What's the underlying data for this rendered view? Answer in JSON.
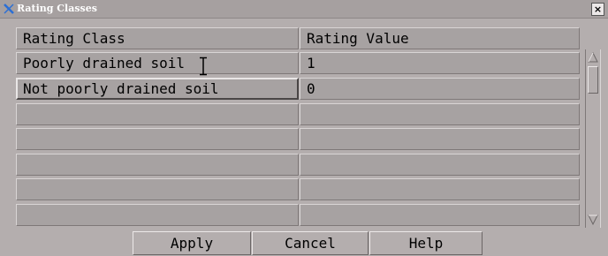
{
  "window": {
    "title": "Rating Classes",
    "close_label": "×"
  },
  "table": {
    "columns": [
      "Rating Class",
      "Rating Value"
    ],
    "rows": [
      [
        "Poorly drained soil",
        "1"
      ],
      [
        "Not poorly drained soil",
        "0"
      ],
      [
        "",
        ""
      ],
      [
        "",
        ""
      ],
      [
        "",
        ""
      ],
      [
        "",
        ""
      ],
      [
        "",
        ""
      ]
    ],
    "selected_row": 1,
    "selected_column": 0
  },
  "buttons": {
    "apply": "Apply",
    "cancel": "Cancel",
    "help": "Help"
  },
  "icons": {
    "title": "x-window-icon",
    "close": "close-icon",
    "scroll_up": "scroll-up-arrow-icon",
    "scroll_down": "scroll-down-arrow-icon",
    "cursor": "text-cursor-icon"
  },
  "colors": {
    "background": "#b4aeae",
    "cell": "#a7a2a2",
    "title_icon": "#2b6fd6"
  }
}
